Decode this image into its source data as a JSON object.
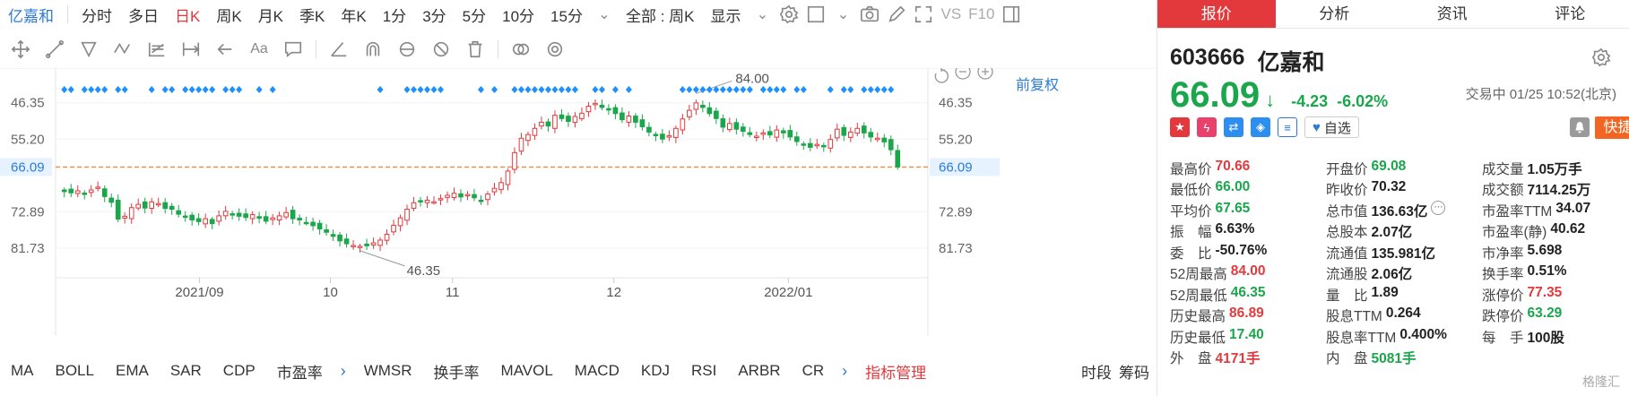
{
  "toolbar": {
    "stock_name": "亿嘉和",
    "periods": [
      "分时",
      "多日",
      "日K",
      "周K",
      "月K",
      "季K",
      "年K",
      "1分",
      "3分",
      "5分",
      "10分",
      "15分"
    ],
    "active_period": "日K",
    "range_select": "全部 : 周K",
    "display_select": "显示",
    "vs_label": "VS",
    "f10_label": "F10"
  },
  "drawbar": {
    "font_label": "Aa"
  },
  "chart": {
    "adjust_label": "前复权",
    "axis_left": [
      "81.73",
      "72.89",
      "66.09",
      "55.20",
      "46.35"
    ],
    "axis_right": [
      "81.73",
      "72.89",
      "66.09",
      "55.20",
      "46.35"
    ],
    "x_labels": [
      "2021/09",
      "10",
      "11",
      "12",
      "2022/01"
    ],
    "annotations": {
      "high": "84.00",
      "low": "46.35"
    },
    "current_price_label": "66.09"
  },
  "chart_data": {
    "type": "candlestick",
    "title": "",
    "xlabel": "",
    "ylabel": "",
    "ylim": [
      40,
      88
    ],
    "y_ticks": [
      46.35,
      55.2,
      66.09,
      72.89,
      81.73
    ],
    "current_price": 66.09,
    "max_marker": 84.0,
    "min_marker": 46.35,
    "x_tick_labels": [
      "2021/09",
      "10",
      "11",
      "12",
      "2022/01"
    ],
    "closes": [
      60.1,
      59.8,
      60.3,
      59.6,
      60.5,
      61.2,
      58.9,
      57.5,
      53.4,
      54.1,
      56.2,
      57.0,
      56.1,
      57.6,
      57.2,
      56.0,
      55.8,
      54.6,
      53.9,
      53.2,
      52.8,
      53.5,
      52.3,
      54.2,
      55.3,
      54.7,
      54.1,
      53.8,
      54.5,
      53.6,
      52.9,
      53.7,
      54.2,
      55.0,
      53.5,
      53.2,
      52.6,
      51.8,
      51.0,
      50.2,
      49.2,
      48.1,
      47.4,
      47.0,
      46.8,
      46.9,
      47.6,
      48.3,
      49.7,
      51.9,
      53.7,
      55.8,
      57.4,
      57.8,
      58.0,
      57.6,
      58.4,
      59.2,
      59.7,
      58.8,
      59.4,
      58.6,
      58.0,
      59.5,
      60.9,
      62.3,
      65.1,
      69.6,
      73.1,
      74.0,
      75.5,
      77.0,
      76.1,
      78.7,
      77.9,
      77.2,
      78.4,
      79.2,
      80.9,
      81.6,
      80.6,
      80.0,
      79.1,
      77.6,
      78.5,
      77.0,
      75.9,
      74.6,
      73.8,
      72.9,
      73.7,
      75.5,
      77.8,
      79.9,
      81.7,
      80.6,
      79.1,
      77.9,
      75.8,
      76.7,
      75.3,
      74.8,
      74.0,
      73.6,
      74.4,
      73.9,
      75.1,
      74.4,
      73.4,
      72.3,
      71.7,
      70.9,
      71.6,
      71.2,
      72.8,
      75.3,
      73.8,
      74.6,
      75.5,
      74.4,
      73.4,
      73.1,
      72.2,
      70.3,
      66.1
    ],
    "volume_markers_note": "blue diamond markers along top of chart"
  },
  "indicators": {
    "items": [
      "MA",
      "BOLL",
      "EMA",
      "SAR",
      "CDP",
      "市盈率",
      "WMSR",
      "换手率",
      "MAVOL",
      "MACD",
      "KDJ",
      "RSI",
      "ARBR",
      "CR"
    ],
    "manage_label": "指标管理",
    "right_items": [
      "时段",
      "筹码"
    ]
  },
  "quote": {
    "tabs": [
      "报价",
      "分析",
      "资讯",
      "评论"
    ],
    "active_tab": "报价",
    "code": "603666",
    "name": "亿嘉和",
    "price": "66.09",
    "change": "-4.23",
    "change_pct": "-6.02%",
    "status": "交易中 01/25 10:52(北京)",
    "fav_label": "自选",
    "quick_trade": "快捷交易",
    "rows": [
      [
        {
          "l": "最高价",
          "v": "70.66",
          "c": "up"
        },
        {
          "l": "开盘价",
          "v": "69.08",
          "c": "dn"
        },
        {
          "l": "成交量",
          "v": "1.05万手",
          "c": ""
        }
      ],
      [
        {
          "l": "最低价",
          "v": "66.00",
          "c": "dn"
        },
        {
          "l": "昨收价",
          "v": "70.32",
          "c": ""
        },
        {
          "l": "成交额",
          "v": "7114.25万",
          "c": ""
        }
      ],
      [
        {
          "l": "平均价",
          "v": "67.65",
          "c": "dn"
        },
        {
          "l": "总市值",
          "v": "136.63亿",
          "c": ""
        },
        {
          "l": "市盈率TTM",
          "v": "34.07",
          "c": ""
        }
      ],
      [
        {
          "l": "振　幅",
          "v": "6.63%",
          "c": ""
        },
        {
          "l": "总股本",
          "v": "2.07亿",
          "c": ""
        },
        {
          "l": "市盈率(静)",
          "v": "40.62",
          "c": ""
        }
      ],
      [
        {
          "l": "委　比",
          "v": "-50.76%",
          "c": ""
        },
        {
          "l": "流通值",
          "v": "135.981亿",
          "c": ""
        },
        {
          "l": "市净率",
          "v": "5.698",
          "c": ""
        }
      ],
      [
        {
          "l": "52周最高",
          "v": "84.00",
          "c": "up"
        },
        {
          "l": "流通股",
          "v": "2.06亿",
          "c": ""
        },
        {
          "l": "换手率",
          "v": "0.51%",
          "c": ""
        }
      ],
      [
        {
          "l": "52周最低",
          "v": "46.35",
          "c": "dn"
        },
        {
          "l": "量　比",
          "v": "1.89",
          "c": ""
        },
        {
          "l": "涨停价",
          "v": "77.35",
          "c": "up"
        }
      ],
      [
        {
          "l": "历史最高",
          "v": "86.89",
          "c": "up"
        },
        {
          "l": "股息TTM",
          "v": "0.264",
          "c": ""
        },
        {
          "l": "跌停价",
          "v": "63.29",
          "c": "dn"
        }
      ],
      [
        {
          "l": "历史最低",
          "v": "17.40",
          "c": "dn"
        },
        {
          "l": "股息率TTM",
          "v": "0.400%",
          "c": ""
        },
        {
          "l": "每　手",
          "v": "100股",
          "c": ""
        }
      ],
      [
        {
          "l": "外　盘",
          "v": "4171手",
          "c": "up"
        },
        {
          "l": "内　盘",
          "v": "5081手",
          "c": "dn"
        },
        {
          "l": "",
          "v": "",
          "c": ""
        }
      ]
    ],
    "watermark": "格隆汇"
  },
  "colors": {
    "up": "#e4393c",
    "down": "#1aa64b",
    "accent": "#2b7bd6",
    "marker": "#1e90ff",
    "price_line": "#f08a3c"
  }
}
